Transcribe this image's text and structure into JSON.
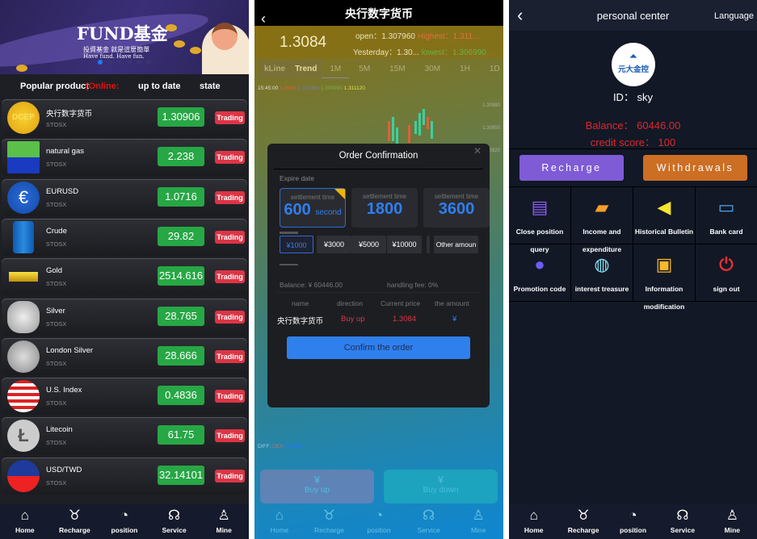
{
  "home": {
    "banner": {
      "title": "FUND基金",
      "subtitle_cn": "投資基金 就是這麼簡單",
      "subtitle_en": "Have fund. Have fun."
    },
    "list_header": {
      "product": "Popular product",
      "online": "(Online:",
      "up_to_date": "up to date",
      "state": "state"
    },
    "products": [
      {
        "name": "央行数字货币",
        "exchange": "STOSX",
        "price": "1.30906",
        "state": "Trading",
        "icon": "dcep-coin-icon",
        "icon_label": "DCEP"
      },
      {
        "name": "natural gas",
        "exchange": "STOSX",
        "price": "2.238",
        "state": "Trading",
        "icon": "natural-gas-icon"
      },
      {
        "name": "EURUSD",
        "exchange": "STOSX",
        "price": "1.0716",
        "state": "Trading",
        "icon": "euro-icon"
      },
      {
        "name": "Crude",
        "exchange": "STOSX",
        "price": "29.82",
        "state": "Trading",
        "icon": "oil-barrel-icon"
      },
      {
        "name": "Gold",
        "exchange": "STOSX",
        "price": "2514.616",
        "state": "Trading",
        "icon": "gold-bar-icon"
      },
      {
        "name": "Silver",
        "exchange": "STOSX",
        "price": "28.765",
        "state": "Trading",
        "icon": "silver-ingot-icon"
      },
      {
        "name": "London Silver",
        "exchange": "STOSX",
        "price": "28.666",
        "state": "Trading",
        "icon": "silver-bars-icon"
      },
      {
        "name": "U.S. Index",
        "exchange": "STOSX",
        "price": "0.4836",
        "state": "Trading",
        "icon": "us-flag-icon"
      },
      {
        "name": "Litecoin",
        "exchange": "STOSX",
        "price": "61.75",
        "state": "Trading",
        "icon": "litecoin-icon"
      },
      {
        "name": "USD/TWD",
        "exchange": "STOSX",
        "price": "32.14101",
        "state": "Trading",
        "icon": "taiwan-flag-icon"
      }
    ]
  },
  "nav": [
    {
      "label": "Home",
      "icon": "home-icon"
    },
    {
      "label": "Recharge",
      "icon": "money-bag-icon"
    },
    {
      "label": "position",
      "icon": "chart-icon"
    },
    {
      "label": "Service",
      "icon": "headset-icon"
    },
    {
      "label": "Mine",
      "icon": "user-icon"
    }
  ],
  "trade": {
    "title": "央行数字货币",
    "price": "1.3084",
    "open_label": "open：",
    "open": "1.307960",
    "high_label": "Highest：",
    "high": "1.311...",
    "yesterday_label": "Yesterday：",
    "yesterday": "1.30...",
    "low_label": "lowest：",
    "low": "1.306990",
    "tabs": [
      "kLine",
      "Trend",
      "1M",
      "5M",
      "15M",
      "30M",
      "1H",
      "1D"
    ],
    "active_tab": "1M",
    "legend": {
      "time": "15:45:00",
      "close": "1.3084",
      "open": "1.307980",
      "low": "1.306990",
      "high": "1.311120"
    },
    "axis": [
      "1.30980",
      "1.30950",
      "1.30920"
    ],
    "macd": {
      "diff": "DIFF:",
      "dea": "DEA:",
      "macd": "MACD:"
    },
    "buy_up": "Buy up",
    "buy_down": "Buy down",
    "modal": {
      "title": "Order Confirmation",
      "expire_label": "Expire date",
      "times": [
        {
          "label": "settlement time",
          "value": "600",
          "unit": "second",
          "selected": true
        },
        {
          "label": "settlement time",
          "value": "1800"
        },
        {
          "label": "settlement time",
          "value": "3600"
        }
      ],
      "amounts": [
        "¥1000",
        "¥3000",
        "¥5000",
        "¥10000"
      ],
      "other_amount": "Other amoun",
      "balance": "Balance: ¥ 60446.00",
      "fee": "handling fee:  0%",
      "headers": [
        "name",
        "direction",
        "Current price",
        "the amount"
      ],
      "row": {
        "name": "央行数字货币",
        "direction": "Buy up",
        "price": "1.3084",
        "amount": "¥"
      },
      "confirm": "Confirm the order",
      "colors": {
        "accent": "#2f80ed",
        "up": "#dc3545"
      }
    }
  },
  "mine": {
    "title": "personal center",
    "language": "Language",
    "avatar_text": "元大金控",
    "id": "ID：  sky",
    "balance": "Balance：  60446.00",
    "credit": "credit score：  100",
    "recharge": "Recharge",
    "withdraw": "Withdrawals",
    "menu": [
      {
        "label": "Close position",
        "label2": "query",
        "icon": "search-document-icon",
        "color": "#8b5cf6"
      },
      {
        "label": "Income and",
        "label2": "expenditure",
        "icon": "wallet-icon",
        "color": "#f59e2b"
      },
      {
        "label": "Historical Bulletin",
        "icon": "speaker-icon",
        "color": "#f5e52b"
      },
      {
        "label": "Bank card",
        "icon": "bank-card-icon",
        "color": "#4aa8f0"
      },
      {
        "label": "Promotion code",
        "icon": "person-icon",
        "color": "#6d5cf6"
      },
      {
        "label": "interest treasure",
        "icon": "headset-icon",
        "color": "#7de0f0"
      },
      {
        "label": "Information",
        "label2": "modification",
        "icon": "lock-icon",
        "color": "#f5b82b"
      },
      {
        "label": "sign out",
        "icon": "power-icon",
        "color": "#e53030"
      }
    ]
  }
}
